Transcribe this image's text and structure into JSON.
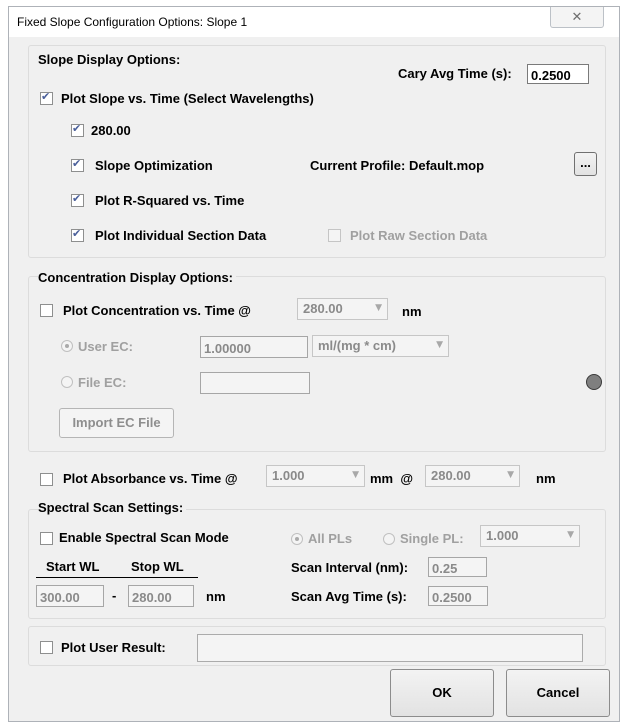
{
  "window": {
    "title": "Fixed Slope Configuration Options:  Slope 1",
    "close_glyph": "✕"
  },
  "slope_display": {
    "heading": "Slope Display Options:",
    "cary_avg_label": "Cary Avg Time (s):",
    "cary_avg_value": "0.2500",
    "plot_slope_label": "Plot Slope vs. Time (Select Wavelengths)",
    "plot_slope_checked": true,
    "wavelength_label": "280.00",
    "wavelength_checked": true,
    "slope_opt_label": "Slope Optimization",
    "slope_opt_checked": true,
    "current_profile_label": "Current Profile: Default.mop",
    "browse_label": "...",
    "plot_rsq_label": "Plot R-Squared vs. Time",
    "plot_rsq_checked": true,
    "plot_individual_label": "Plot Individual Section Data",
    "plot_individual_checked": true,
    "plot_raw_label": "Plot Raw Section Data",
    "plot_raw_checked": false
  },
  "concentration": {
    "heading": "Concentration Display Options:",
    "plot_conc_label": "Plot Concentration vs. Time @",
    "plot_conc_checked": false,
    "wavelength_value": "280.00",
    "nm_label": "nm",
    "user_ec_label": "User EC:",
    "user_ec_value": "1.00000",
    "units_value": "ml/(mg * cm)",
    "file_ec_label": "File EC:",
    "file_ec_value": "",
    "import_label": "Import EC File",
    "status_color": "#7f7f7f"
  },
  "absorbance": {
    "plot_abs_label": "Plot Absorbance vs. Time @",
    "plot_abs_checked": false,
    "pathlength_value": "1.000",
    "mm_at_label": "mm  @",
    "wavelength_value": "280.00",
    "nm_label": "nm"
  },
  "spectral": {
    "heading": "Spectral Scan Settings:",
    "enable_label": "Enable Spectral Scan Mode",
    "enable_checked": false,
    "all_pls_label": "All PLs",
    "single_pl_label": "Single PL:",
    "single_pl_value": "1.000",
    "start_wl_label": "Start WL",
    "stop_wl_label": "Stop WL",
    "start_wl_value": "300.00",
    "dash": "-",
    "stop_wl_value": "280.00",
    "nm_label": "nm",
    "scan_interval_label": "Scan Interval (nm):",
    "scan_interval_value": "0.25",
    "scan_avg_label": "Scan Avg Time (s):",
    "scan_avg_value": "0.2500"
  },
  "user_result": {
    "label": "Plot User Result:",
    "checked": false,
    "value": ""
  },
  "buttons": {
    "ok": "OK",
    "cancel": "Cancel"
  }
}
